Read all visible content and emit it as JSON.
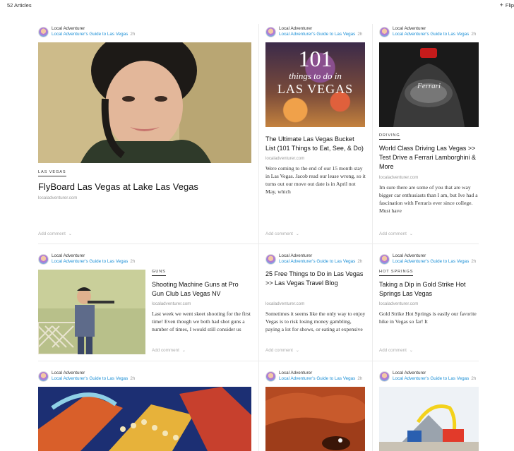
{
  "header": {
    "article_count": "52 Articles",
    "flip_label": "Flip"
  },
  "attribution": {
    "author": "Local Adventurer",
    "magazine": "Local Adventurer's Guide to Las Vegas",
    "age": "2h"
  },
  "comment_label": "Add comment",
  "cards": {
    "flyboard": {
      "section": "LAS VEGAS",
      "title": "FlyBoard Las Vegas at Lake Las Vegas",
      "domain": "localadventurer.com"
    },
    "bucket": {
      "image_text_big": "101",
      "image_text_mid": "things to do in",
      "image_text_bottom": "LAS VEGAS",
      "title": "The Ultimate Las Vegas Bucket List (101 Things to Eat, See, & Do)",
      "domain": "localadventurer.com",
      "excerpt": "Were coming to the end of our 15 month stay in Las Vegas. Jacob read our lease wrong, so it turns out our move out date is in April not May, which"
    },
    "driving": {
      "section": "DRIVING",
      "image_text": "Ferrari",
      "title": "World Class Driving Las Vegas >> Test Drive a Ferrari Lamborghini & More",
      "domain": "localadventurer.com",
      "excerpt": "Im sure there are some of you that are way bigger car enthusiasts than I am, but Ive had a fascination with Ferraris ever since college. Must have"
    },
    "guns": {
      "section": "GUNS",
      "title": "Shooting Machine Guns at Pro Gun Club Las Vegas NV",
      "domain": "localadventurer.com",
      "excerpt": "Last week we went skeet shooting for the first time! Even though we both had shot guns a number of times, I would still consider us"
    },
    "free": {
      "title": "25 Free Things to Do in Las Vegas >> Las Vegas Travel Blog",
      "domain": "localadventurer.com",
      "excerpt": "Sometimes it seems like the only way to enjoy Vegas is to risk losing money gambling, paying a lot for shows, or eating at expensive"
    },
    "hotsprings": {
      "section": "HOT SPRINGS",
      "title": "Taking a Dip in Gold Strike Hot Springs Las Vegas",
      "domain": "localadventurer.com",
      "excerpt": "Gold Strike Hot Springs is easily our favorite hike in Vegas so far! It"
    }
  },
  "colors": {
    "accent_link": "#1b8fd6",
    "divider": "#ececec"
  }
}
